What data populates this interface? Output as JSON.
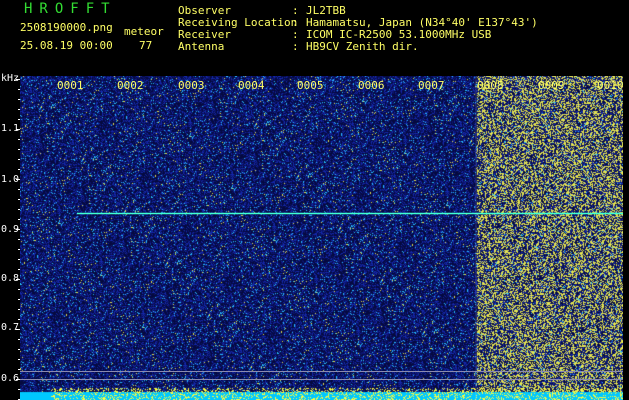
{
  "app": {
    "title": "HROFFT"
  },
  "file": {
    "name": "2508190000.png",
    "datetime": "25.08.19 00:00"
  },
  "counter": {
    "label": "meteor",
    "value": "77"
  },
  "info": [
    {
      "label": "Observer",
      "value": "JL2TBB"
    },
    {
      "label": "Receiving Location",
      "value": "Hamamatsu, Japan (N34°40' E137°43')"
    },
    {
      "label": "Receiver",
      "value": "ICOM IC-R2500 53.1000MHz USB"
    },
    {
      "label": "Antenna",
      "value": "HB9CV Zenith dir."
    }
  ],
  "separator": ":",
  "axis": {
    "unit": "kHz",
    "y_ticks": [
      "1.1",
      "1.0",
      "0.9",
      "0.8",
      "0.7",
      "0.6"
    ],
    "x_ticks": [
      "0001",
      "0002",
      "0003",
      "0004",
      "0005",
      "0006",
      "0007",
      "0008",
      "0009",
      "0010"
    ]
  },
  "colors": {
    "background": "#050a40",
    "header_text": "#ffff66",
    "title": "#33dd33",
    "trace": "#40ffd0",
    "noise_high": "#ffff40",
    "noise_low": "#20d0ff"
  }
}
